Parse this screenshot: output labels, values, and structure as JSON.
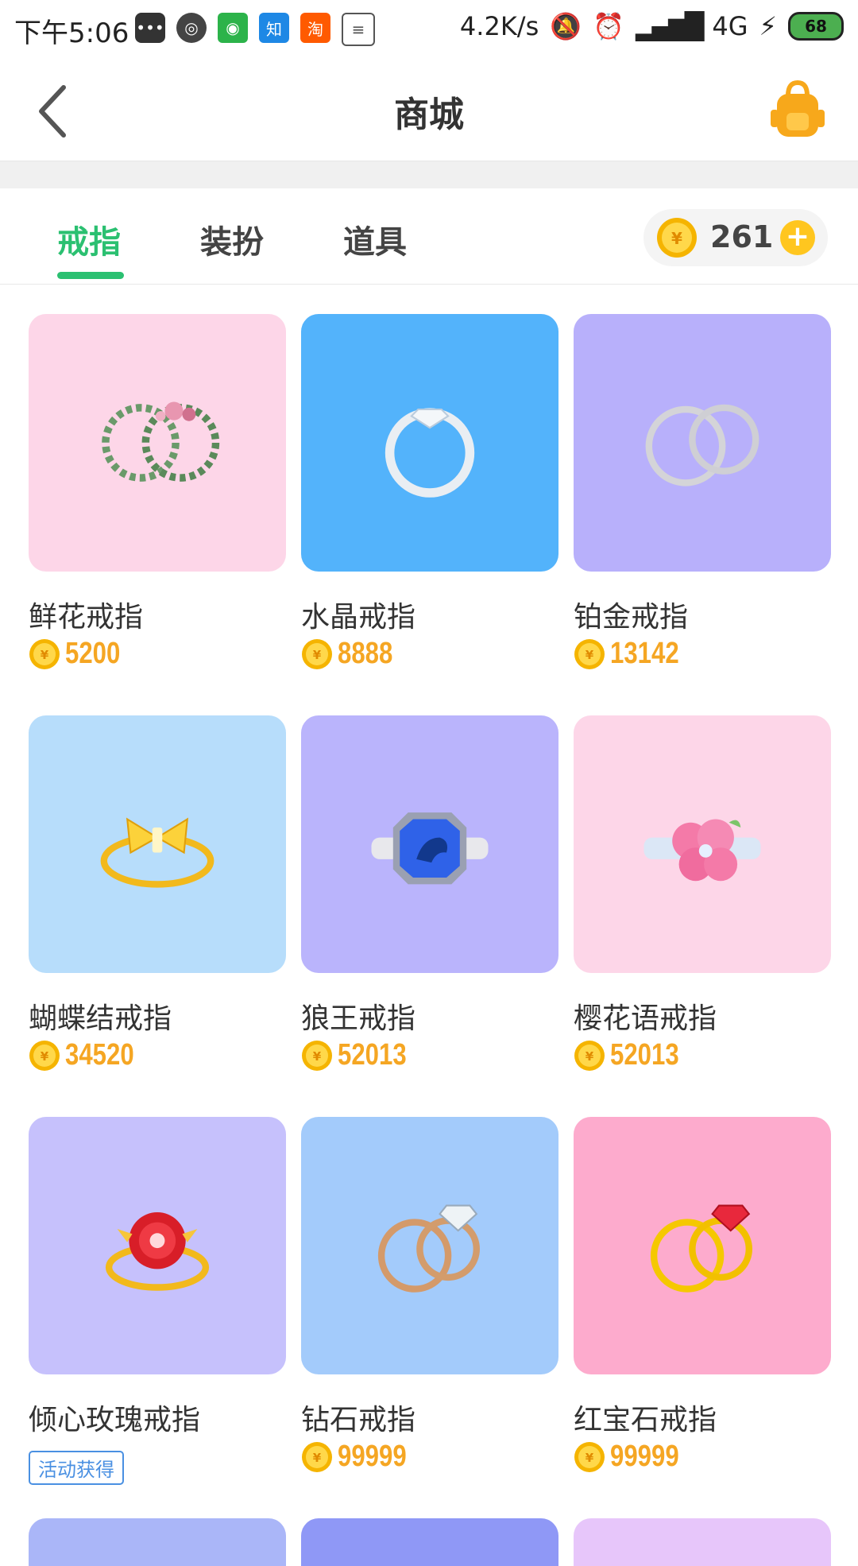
{
  "status_bar": {
    "time": "下午5:06",
    "net_speed": "4.2K/s",
    "network": "4G",
    "battery": "68"
  },
  "header": {
    "title": "商城"
  },
  "tabs": [
    {
      "label": "戒指",
      "active": true
    },
    {
      "label": "装扮",
      "active": false
    },
    {
      "label": "道具",
      "active": false
    }
  ],
  "wallet": {
    "coins": "261",
    "plus": "+"
  },
  "coin_symbol": "¥",
  "items": [
    {
      "name": "鲜花戒指",
      "price": "5200",
      "bg": "#fdd6e8",
      "ring": "wreath"
    },
    {
      "name": "水晶戒指",
      "price": "8888",
      "bg": "#53b3fb",
      "ring": "crystal"
    },
    {
      "name": "铂金戒指",
      "price": "13142",
      "bg": "#b8b0fb",
      "ring": "platinum"
    },
    {
      "name": "蝴蝶结戒指",
      "price": "34520",
      "bg": "#b7ddfb",
      "ring": "bow"
    },
    {
      "name": "狼王戒指",
      "price": "52013",
      "bg": "#bab4fc",
      "ring": "wolf"
    },
    {
      "name": "樱花语戒指",
      "price": "52013",
      "bg": "#fdd6e8",
      "ring": "sakura"
    },
    {
      "name": "倾心玫瑰戒指",
      "price": "",
      "badge": "活动获得",
      "bg": "#c6c1fc",
      "ring": "rose"
    },
    {
      "name": "钻石戒指",
      "price": "99999",
      "bg": "#a3cbfb",
      "ring": "diamond"
    },
    {
      "name": "红宝石戒指",
      "price": "99999",
      "bg": "#fdabcd",
      "ring": "ruby"
    }
  ],
  "next_row_colors": [
    "#aab6f8",
    "#8f98f6",
    "#e7c6fa"
  ]
}
